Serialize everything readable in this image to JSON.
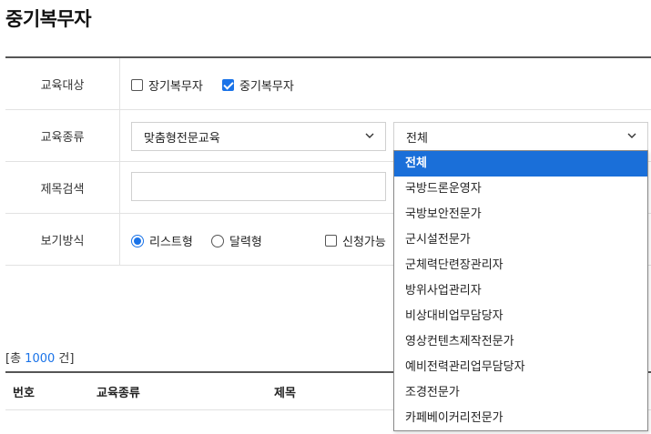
{
  "page": {
    "title": "중기복무자"
  },
  "form": {
    "target": {
      "label": "교육대상",
      "options": [
        {
          "label": "장기복무자",
          "checked": false
        },
        {
          "label": "중기복무자",
          "checked": true
        }
      ]
    },
    "type": {
      "label": "교육종류",
      "primary_select": "맞춤형전문교육",
      "secondary_select": "전체"
    },
    "search": {
      "label": "제목검색",
      "value": ""
    },
    "view": {
      "label": "보기방식",
      "options": [
        {
          "label": "리스트형",
          "checked": true
        },
        {
          "label": "달력형",
          "checked": false
        }
      ],
      "available_label": "신청가능"
    }
  },
  "list": {
    "total_prefix": "[총 ",
    "total_count": "1000",
    "total_suffix": " 건]",
    "headers": {
      "number": "번호",
      "type": "교육종류",
      "title": "제목"
    }
  },
  "dropdown": {
    "items": [
      "전체",
      "국방드론운영자",
      "국방보안전문가",
      "군시설전문가",
      "군체력단련장관리자",
      "방위사업관리자",
      "비상대비업무담당자",
      "영상컨텐츠제작전문가",
      "예비전력관리업무담당자",
      "조경전문가",
      "카페베이커리전문가"
    ],
    "selected_index": 0
  },
  "colors": {
    "accent": "#1a73e8",
    "highlight": "#1a6fd9"
  }
}
